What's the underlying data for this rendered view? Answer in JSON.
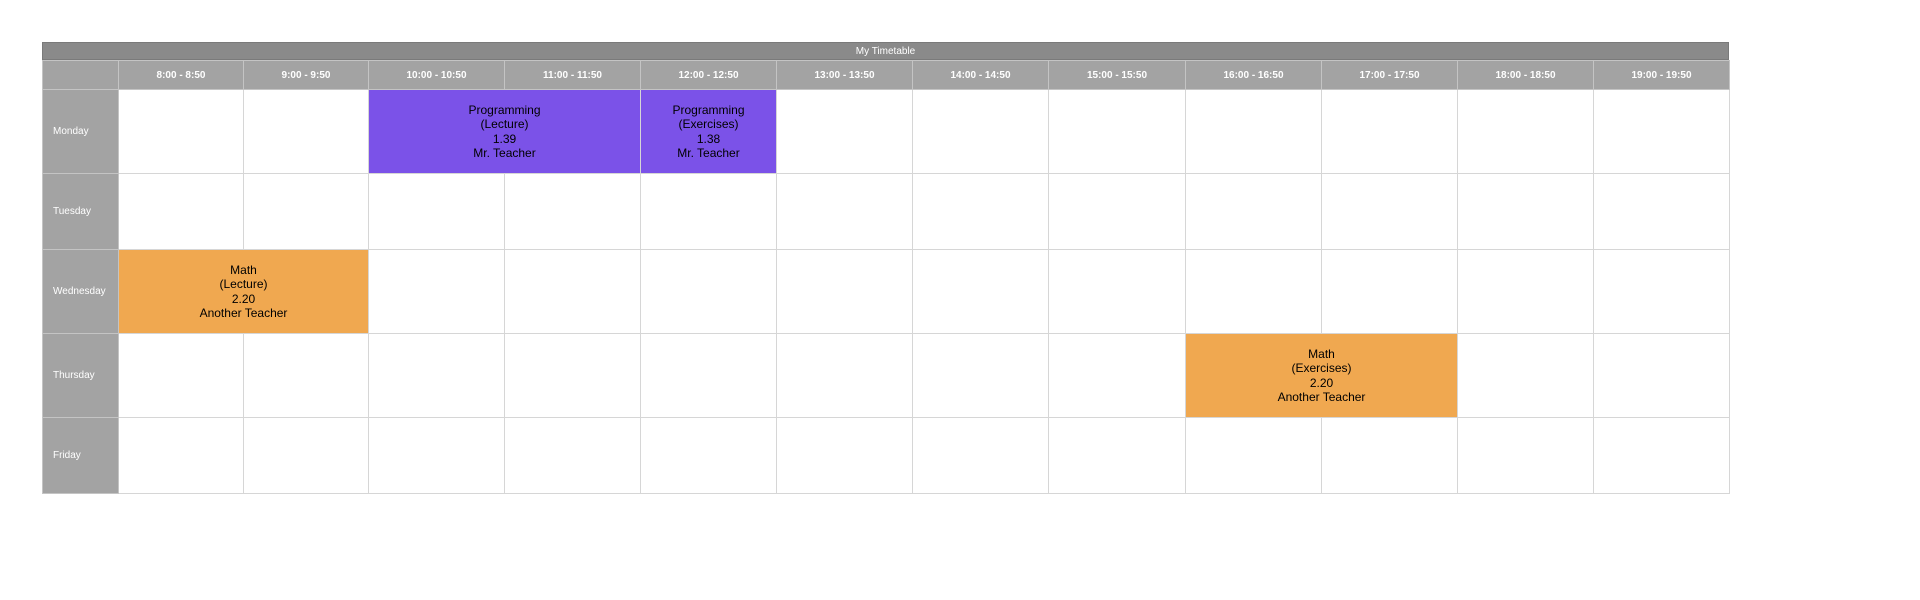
{
  "timetable": {
    "title": "My Timetable",
    "slots": [
      "8:00 - 8:50",
      "9:00 - 9:50",
      "10:00 - 10:50",
      "11:00 - 11:50",
      "12:00 - 12:50",
      "13:00 - 13:50",
      "14:00 - 14:50",
      "15:00 - 15:50",
      "16:00 - 16:50",
      "17:00 - 17:50",
      "18:00 - 18:50",
      "19:00 - 19:50"
    ],
    "days": [
      "Monday",
      "Tuesday",
      "Wednesday",
      "Thursday",
      "Friday"
    ],
    "colors": {
      "header_bg": "#a3a3a3",
      "title_bg": "#8a8a8a",
      "programming": "#7b52e8",
      "math": "#f0a850"
    },
    "events": {
      "mon_programming_lecture": {
        "course": "Programming",
        "type": "(Lecture)",
        "room": "1.39",
        "teacher": "Mr. Teacher"
      },
      "mon_programming_exercises": {
        "course": "Programming",
        "type": "(Exercises)",
        "room": "1.38",
        "teacher": "Mr. Teacher"
      },
      "wed_math_lecture": {
        "course": "Math",
        "type": "(Lecture)",
        "room": "2.20",
        "teacher": "Another Teacher"
      },
      "thu_math_exercises": {
        "course": "Math",
        "type": "(Exercises)",
        "room": "2.20",
        "teacher": "Another Teacher"
      }
    }
  }
}
